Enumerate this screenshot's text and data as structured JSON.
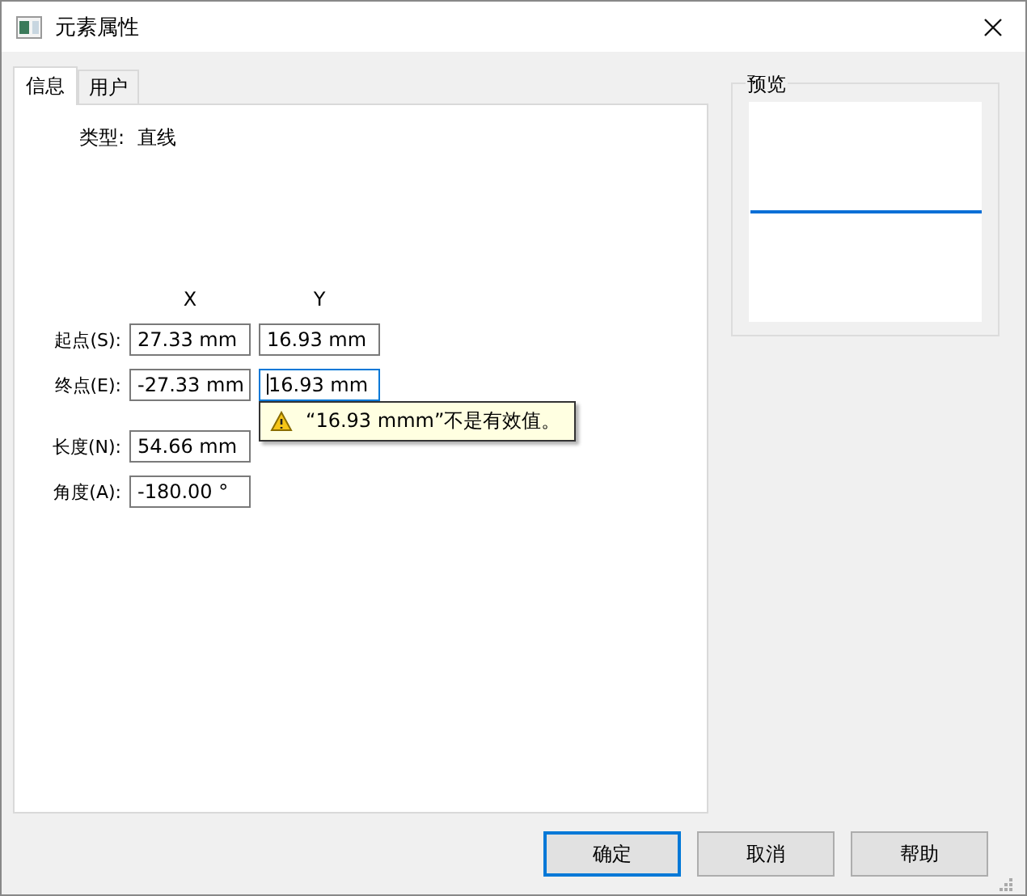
{
  "window": {
    "title": "元素属性"
  },
  "tabs": [
    {
      "label": "信息",
      "selected": true
    },
    {
      "label": "用户",
      "selected": false
    }
  ],
  "type": {
    "label": "类型:",
    "value": "直线"
  },
  "columns": [
    "X",
    "Y"
  ],
  "rows": [
    {
      "label": "起点(S):",
      "x": "27.33 mm",
      "y": "16.93 mm",
      "y_focused": false
    },
    {
      "label": "终点(E):",
      "x": "-27.33 mm",
      "y": "16.93 mm",
      "y_focused": true,
      "tooltip": "“16.93 mmm”不是有效值。"
    },
    {
      "label": "长度(N):",
      "x": "54.66 mm"
    },
    {
      "label": "角度(A):",
      "x": "-180.00 °"
    }
  ],
  "preview": {
    "title": "预览"
  },
  "buttons": [
    {
      "label": "确定",
      "default": true
    },
    {
      "label": "取消",
      "default": false
    },
    {
      "label": "帮助",
      "default": false
    }
  ]
}
